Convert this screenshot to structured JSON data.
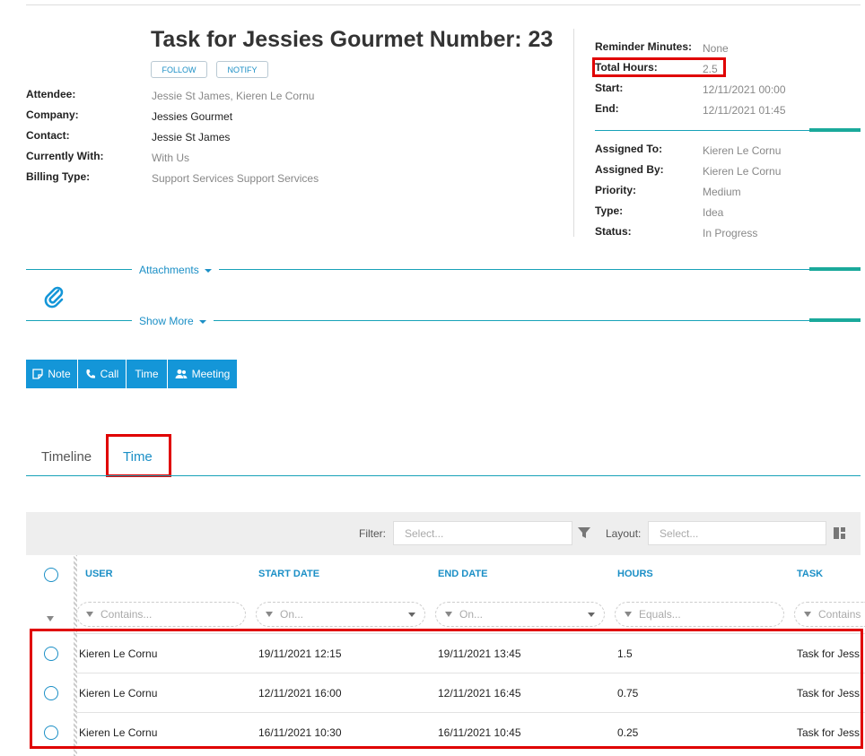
{
  "task": {
    "title": "Task for Jessies Gourmet Number: 23",
    "follow_label": "FOLLOW",
    "notify_label": "NOTIFY"
  },
  "details_left": [
    {
      "label": "Attendee:",
      "value": "Jessie St James, Kieren Le Cornu"
    },
    {
      "label": "Company:",
      "value": "Jessies Gourmet"
    },
    {
      "label": "Contact:",
      "value": "Jessie St James"
    },
    {
      "label": "Currently With:",
      "value": "With Us"
    },
    {
      "label": "Billing Type:",
      "value": "Support Services Support Services"
    }
  ],
  "details_right_top": [
    {
      "label": "Reminder Minutes:",
      "value": "None"
    },
    {
      "label": "Total Hours:",
      "value": "2.5"
    },
    {
      "label": "Start:",
      "value": "12/11/2021 00:00"
    },
    {
      "label": "End:",
      "value": "12/11/2021 01:45"
    }
  ],
  "details_right_bottom": [
    {
      "label": "Assigned To:",
      "value": "Kieren Le Cornu"
    },
    {
      "label": "Assigned By:",
      "value": "Kieren Le Cornu"
    },
    {
      "label": "Priority:",
      "value": "Medium"
    },
    {
      "label": "Type:",
      "value": "Idea"
    },
    {
      "label": "Status:",
      "value": "In Progress"
    }
  ],
  "sections": {
    "attachments": "Attachments",
    "show_more": "Show More"
  },
  "actions": {
    "note": "Note",
    "call": "Call",
    "time": "Time",
    "meeting": "Meeting"
  },
  "tabs": {
    "timeline": "Timeline",
    "time": "Time"
  },
  "toolbar": {
    "filter_label": "Filter:",
    "filter_placeholder": "Select...",
    "layout_label": "Layout:",
    "layout_placeholder": "Select..."
  },
  "grid": {
    "columns": [
      "USER",
      "START DATE",
      "END DATE",
      "HOURS",
      "TASK"
    ],
    "filters": [
      "Contains...",
      "On...",
      "On...",
      "Equals...",
      "Contains"
    ],
    "rows": [
      {
        "user": "Kieren Le Cornu",
        "start": "19/11/2021 12:15",
        "end": "19/11/2021 13:45",
        "hours": "1.5",
        "task": "Task for Jess"
      },
      {
        "user": "Kieren Le Cornu",
        "start": "12/11/2021 16:00",
        "end": "12/11/2021 16:45",
        "hours": "0.75",
        "task": "Task for Jess"
      },
      {
        "user": "Kieren Le Cornu",
        "start": "16/11/2021 10:30",
        "end": "16/11/2021 10:45",
        "hours": "0.25",
        "task": "Task for Jess"
      }
    ]
  },
  "colors": {
    "accent": "#1496d8",
    "link": "#1b8fc6",
    "teal": "#1aa99b",
    "highlight": "#e00000"
  }
}
